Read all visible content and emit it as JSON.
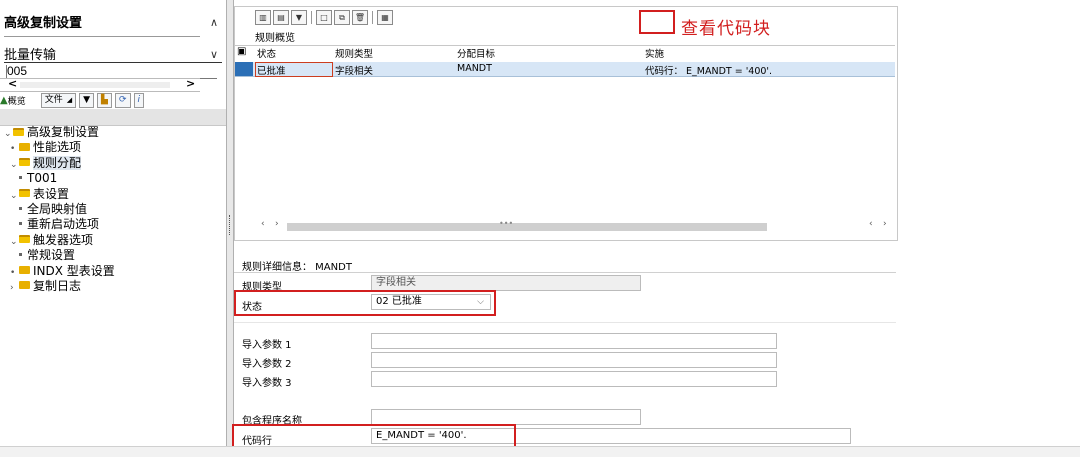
{
  "left_panel": {
    "title": "高级复制设置",
    "subtitle": "批量传输",
    "subtitle_value": "005",
    "toolbar": {
      "overview_label": "概览",
      "file_label": "文件"
    },
    "tree": [
      {
        "label": "高级复制设置",
        "level": 0,
        "expanded": true,
        "folder": true
      },
      {
        "label": "性能选项",
        "level": 1,
        "folder": true
      },
      {
        "label": "规则分配",
        "level": 1,
        "expanded": true,
        "folder": true,
        "selected": true
      },
      {
        "label": "T001",
        "level": 2
      },
      {
        "label": "表设置",
        "level": 1,
        "expanded": true,
        "folder": true
      },
      {
        "label": "全局映射值",
        "level": 2
      },
      {
        "label": "重新启动选项",
        "level": 2
      },
      {
        "label": "触发器选项",
        "level": 1,
        "expanded": true,
        "folder": true
      },
      {
        "label": "常规设置",
        "level": 2
      },
      {
        "label": "INDX 型表设置",
        "level": 1,
        "folder": true
      },
      {
        "label": "复制日志",
        "level": 1,
        "collapsed": true,
        "folder": true
      }
    ]
  },
  "rules_overview": {
    "section_title": "规则概览",
    "callout": "查看代码块",
    "columns": [
      "状态",
      "规则类型",
      "分配目标",
      "实施"
    ],
    "rows": [
      {
        "status": "已批准",
        "rule_type": "字段相关",
        "target": "MANDT",
        "implementation": "代码行： E_MANDT = '400'."
      }
    ]
  },
  "rule_detail": {
    "header": "规则详细信息：  MANDT",
    "fields": {
      "rule_type_label": "规则类型",
      "rule_type_value": "字段相关",
      "status_label": "状态",
      "status_value": "02 已批准",
      "import_param1_label": "导入参数 1",
      "import_param2_label": "导入参数 2",
      "import_param3_label": "导入参数 3",
      "include_program_label": "包含程序名称",
      "code_line_label": "代码行",
      "code_line_value": "E_MANDT = '400'."
    }
  },
  "colors": {
    "selected_row": "#d7e6f6",
    "annotation_red": "#d21f1f",
    "folder_yellow": "#e8b000"
  }
}
